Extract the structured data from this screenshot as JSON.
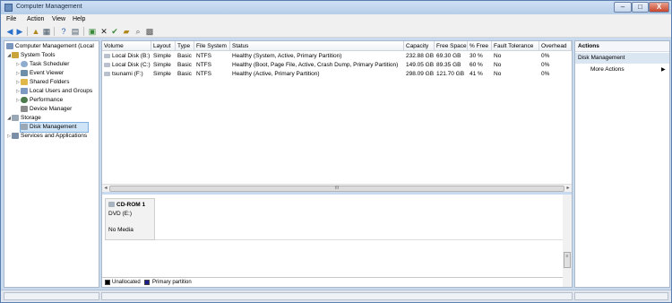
{
  "window": {
    "title": "Computer Management"
  },
  "window_controls": {
    "minimize": "–",
    "maximize": "□",
    "close": "X"
  },
  "menu": [
    "File",
    "Action",
    "View",
    "Help"
  ],
  "toolbar_icons": [
    "back-arrow-icon",
    "forward-arrow-icon",
    "up-folder-icon",
    "show-hide-tree-icon",
    "help-icon",
    "properties-icon",
    "export-list-icon",
    "delete-icon",
    "check-icon",
    "open-icon",
    "search-icon",
    "magnify-icon"
  ],
  "tree": {
    "root": "Computer Management (Local",
    "items": [
      {
        "label": "System Tools",
        "level": 1
      },
      {
        "label": "Task Scheduler",
        "level": 2
      },
      {
        "label": "Event Viewer",
        "level": 2
      },
      {
        "label": "Shared Folders",
        "level": 2
      },
      {
        "label": "Local Users and Groups",
        "level": 2
      },
      {
        "label": "Performance",
        "level": 2
      },
      {
        "label": "Device Manager",
        "level": 2
      },
      {
        "label": "Storage",
        "level": 1
      },
      {
        "label": "Disk Management",
        "level": 2,
        "selected": true
      },
      {
        "label": "Services and Applications",
        "level": 1
      }
    ]
  },
  "volumes": {
    "columns": [
      "Volume",
      "Layout",
      "Type",
      "File System",
      "Status",
      "Capacity",
      "Free Space",
      "% Free",
      "Fault Tolerance",
      "Overhead"
    ],
    "rows": [
      [
        "Local Disk (B:)",
        "Simple",
        "Basic",
        "NTFS",
        "Healthy (System, Active, Primary Partition)",
        "232.88 GB",
        "69.30 GB",
        "30 %",
        "No",
        "0%"
      ],
      [
        "Local Disk (C:)",
        "Simple",
        "Basic",
        "NTFS",
        "Healthy (Boot, Page File, Active, Crash Dump, Primary Partition)",
        "149.05 GB",
        "89.35 GB",
        "60 %",
        "No",
        "0%"
      ],
      [
        "tsunami (F:)",
        "Simple",
        "Basic",
        "NTFS",
        "Healthy (Active, Primary Partition)",
        "298.09 GB",
        "121.70 GB",
        "41 %",
        "No",
        "0%"
      ]
    ]
  },
  "disk": {
    "name": "CD-ROM 1",
    "drive": "DVD (E:)",
    "media": "No Media"
  },
  "legend": [
    {
      "label": "Unallocated",
      "color": "#000000"
    },
    {
      "label": "Primary partition",
      "color": "#1c1c8c"
    }
  ],
  "actions": {
    "title": "Actions",
    "section": "Disk Management",
    "item": "More Actions"
  },
  "scroll_grip": "III"
}
